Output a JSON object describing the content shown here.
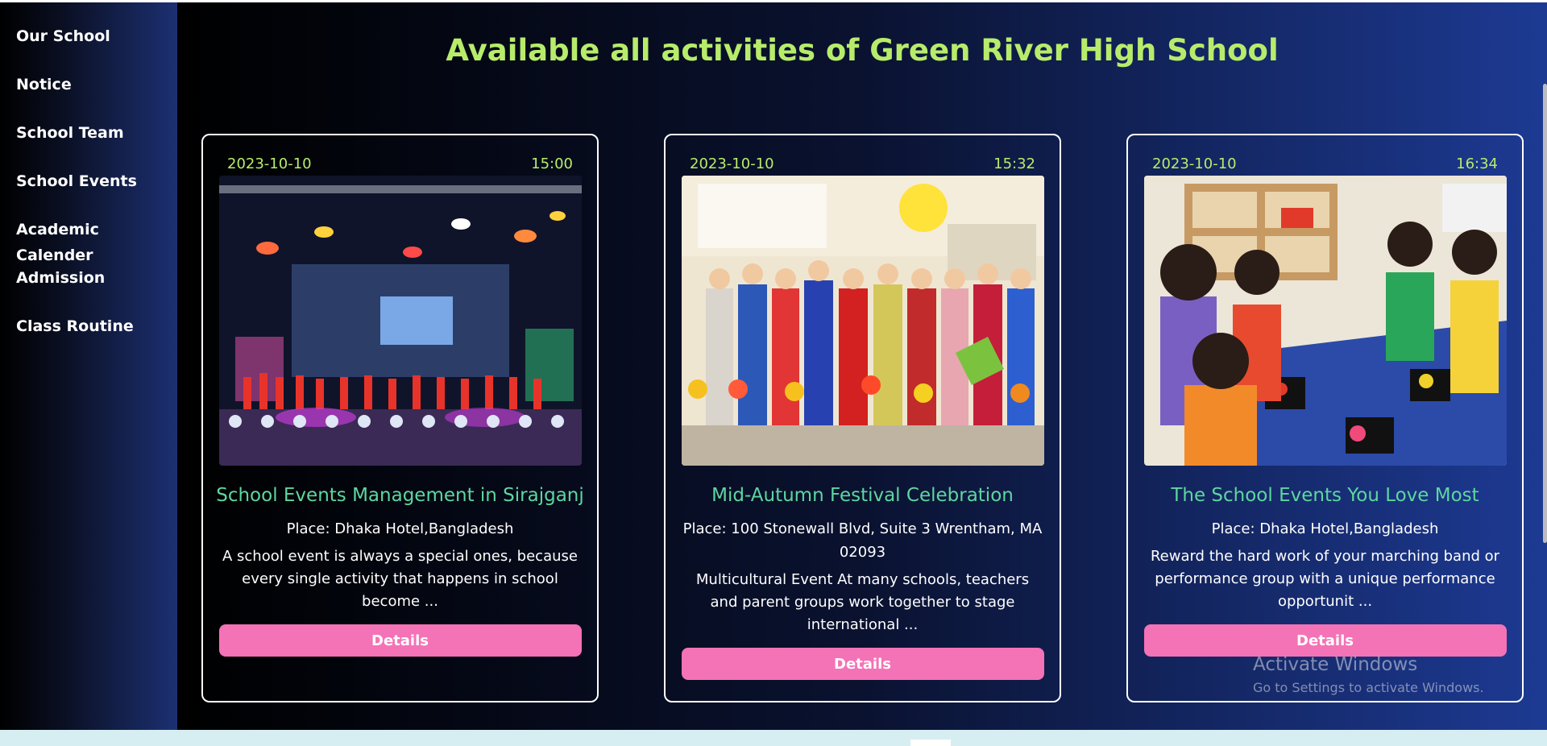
{
  "sidebar": {
    "items": [
      {
        "label": "Our School"
      },
      {
        "label": "Notice"
      },
      {
        "label": "School Team"
      },
      {
        "label": "School Events"
      },
      {
        "label": "Academic Calender"
      },
      {
        "label": "Admission"
      },
      {
        "label": "Class Routine"
      }
    ]
  },
  "page": {
    "title": "Available all activities of Green River High School"
  },
  "cards": [
    {
      "date": "2023-10-10",
      "time": "15:00",
      "title": "School Events Management in Sirajganj",
      "place": "Place: Dhaka Hotel,Bangladesh",
      "description": "A school event is always a special ones, because every single activity that happens in school become ...",
      "button": "Details"
    },
    {
      "date": "2023-10-10",
      "time": "15:32",
      "title": "Mid-Autumn Festival Celebration",
      "place": "Place: 100 Stonewall Blvd, Suite 3 Wrentham, MA 02093",
      "description": "Multicultural Event At many schools, teachers and parent groups work together to stage international ...",
      "button": "Details"
    },
    {
      "date": "2023-10-10",
      "time": "16:34",
      "title": "The School Events You Love Most",
      "place": "Place: Dhaka Hotel,Bangladesh",
      "description": "Reward the hard work of your marching band or performance group with a unique performance opportunit ...",
      "button": "Details"
    }
  ],
  "watermark": {
    "line1": "Activate Windows",
    "line2": "Go to Settings to activate Windows."
  },
  "colors": {
    "accent_green": "#b7ec6b",
    "title_teal": "#5ed6a0",
    "button_pink": "#f472b6"
  }
}
